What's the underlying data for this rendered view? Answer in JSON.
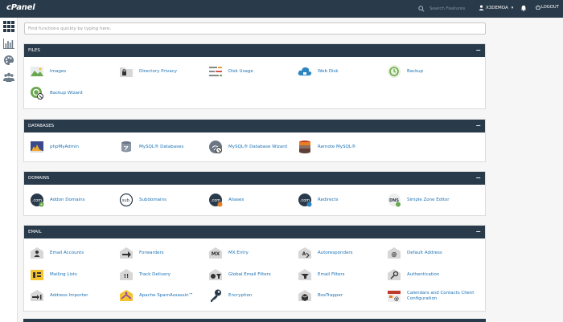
{
  "header": {
    "logo": "cPanel",
    "search_placeholder": "Search Features",
    "username": "X3DEMOA",
    "logout": "LOGOUT"
  },
  "rail": [
    {
      "icon": "grid-icon"
    },
    {
      "icon": "bar-chart-icon"
    },
    {
      "icon": "palette-icon"
    },
    {
      "icon": "users-icon"
    }
  ],
  "filter_placeholder": "Find functions quickly by typing here.",
  "sections": [
    {
      "title": "FILES",
      "items": [
        {
          "label": "Images",
          "icon": "images-icon"
        },
        {
          "label": "Directory Privacy",
          "icon": "folder-lock-icon"
        },
        {
          "label": "Disk Usage",
          "icon": "disk-usage-icon"
        },
        {
          "label": "Web Disk",
          "icon": "cloud-icon"
        },
        {
          "label": "Backup",
          "icon": "backup-icon"
        },
        {
          "label": "Backup Wizard",
          "icon": "backup-wizard-icon"
        }
      ]
    },
    {
      "title": "DATABASES",
      "items": [
        {
          "label": "phpMyAdmin",
          "icon": "phpmyadmin-icon"
        },
        {
          "label": "MySQL® Databases",
          "icon": "database-icon"
        },
        {
          "label": "MySQL® Database Wizard",
          "icon": "database-wizard-icon"
        },
        {
          "label": "Remote MySQL®",
          "icon": "remote-database-icon"
        }
      ]
    },
    {
      "title": "DOMAINS",
      "items": [
        {
          "label": "Addon Domains",
          "icon": "addon-domains-icon"
        },
        {
          "label": "Subdomains",
          "icon": "subdomains-icon"
        },
        {
          "label": "Aliases",
          "icon": "aliases-icon"
        },
        {
          "label": "Redirects",
          "icon": "redirects-icon"
        },
        {
          "label": "Simple Zone Editor",
          "icon": "dns-icon"
        }
      ]
    },
    {
      "title": "EMAIL",
      "items": [
        {
          "label": "Email Accounts",
          "icon": "email-accounts-icon"
        },
        {
          "label": "Forwarders",
          "icon": "forwarders-icon"
        },
        {
          "label": "MX Entry",
          "icon": "mx-entry-icon"
        },
        {
          "label": "Autoresponders",
          "icon": "autoresponders-icon"
        },
        {
          "label": "Default Address",
          "icon": "default-address-icon"
        },
        {
          "label": "Mailing Lists",
          "icon": "mailing-lists-icon"
        },
        {
          "label": "Track Delivery",
          "icon": "track-delivery-icon"
        },
        {
          "label": "Global Email Filters",
          "icon": "global-filters-icon"
        },
        {
          "label": "Email Filters",
          "icon": "email-filters-icon"
        },
        {
          "label": "Authentication",
          "icon": "authentication-icon"
        },
        {
          "label": "Address Importer",
          "icon": "address-importer-icon"
        },
        {
          "label": "Apache SpamAssassin™",
          "icon": "spamassassin-icon"
        },
        {
          "label": "Encryption",
          "icon": "encryption-icon"
        },
        {
          "label": "BoxTrapper",
          "icon": "boxtrapper-icon"
        },
        {
          "label": "Calendars and Contacts Client Configuration",
          "icon": "calendar-contacts-icon"
        }
      ]
    }
  ]
}
